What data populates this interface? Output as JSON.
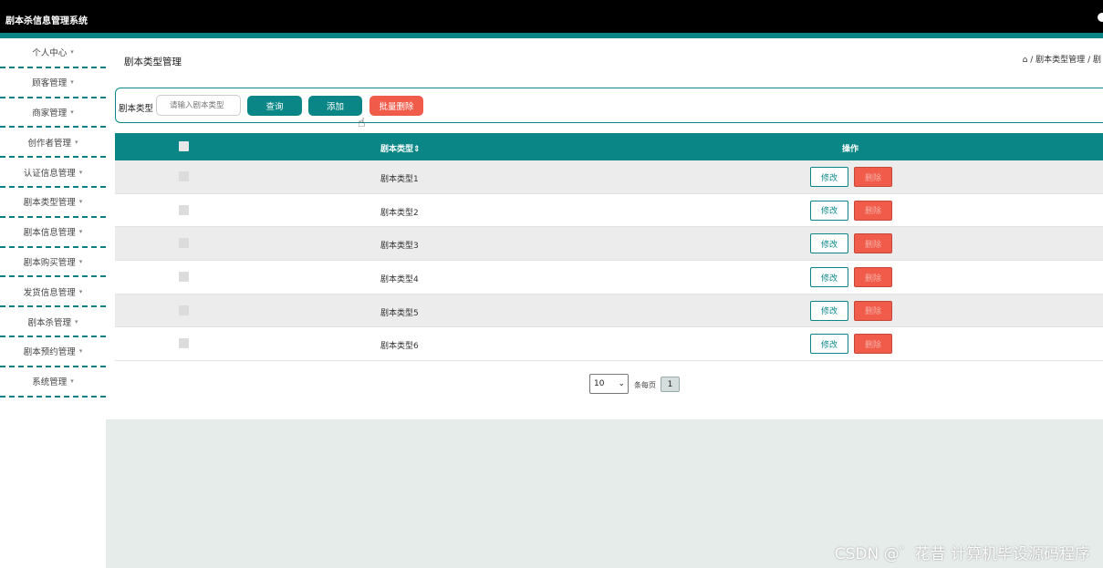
{
  "app": {
    "title": "剧本杀信息管理系统"
  },
  "sidebar": {
    "items": [
      {
        "label": "个人中心"
      },
      {
        "label": "顾客管理"
      },
      {
        "label": "商家管理"
      },
      {
        "label": "创作者管理"
      },
      {
        "label": "认证信息管理"
      },
      {
        "label": "剧本类型管理"
      },
      {
        "label": "剧本信息管理"
      },
      {
        "label": "剧本购买管理"
      },
      {
        "label": "发货信息管理"
      },
      {
        "label": "剧本杀管理"
      },
      {
        "label": "剧本预约管理"
      },
      {
        "label": "系统管理"
      }
    ],
    "caret": "▾"
  },
  "page": {
    "title": "剧本类型管理",
    "breadcrumb": {
      "home_icon": "home-icon",
      "sep": "/",
      "current": "剧本类型管理",
      "trail": "剧"
    }
  },
  "search": {
    "label": "剧本类型",
    "placeholder": "请输入剧本类型",
    "query_label": "查询",
    "add_label": "添加",
    "batch_delete_label": "批量删除"
  },
  "table": {
    "columns": {
      "name": "剧本类型⇕",
      "ops": "操作"
    },
    "rows": [
      {
        "name": "剧本类型1"
      },
      {
        "name": "剧本类型2"
      },
      {
        "name": "剧本类型3"
      },
      {
        "name": "剧本类型4"
      },
      {
        "name": "剧本类型5"
      },
      {
        "name": "剧本类型6"
      }
    ],
    "edit_label": "修改",
    "delete_label": "删除"
  },
  "pager": {
    "page_size": "10",
    "per_page_label": "条每页",
    "current_page": "1"
  },
  "watermark": "CSDN @゛花昔 计算机毕设源码程序",
  "colors": {
    "primary": "#0a8686",
    "danger": "#f05b4a",
    "topbar": "#000000"
  }
}
